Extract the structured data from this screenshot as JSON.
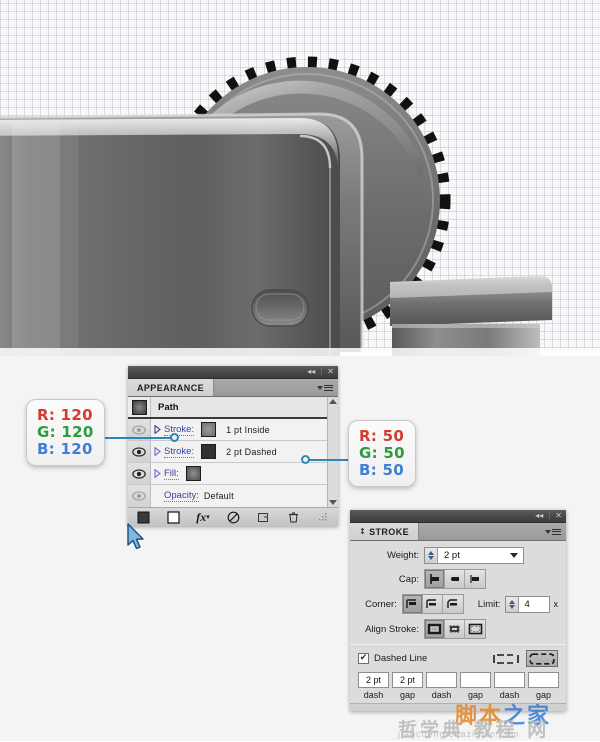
{
  "artboard": {
    "description": "Adobe Illustrator artboard showing a grayscale vector webcam / appliance illustration on a transparency grid"
  },
  "appearance_panel": {
    "window": {
      "collapse_label": "◂◂",
      "close_label": "✕",
      "separator": "|"
    },
    "tab_label": "APPEARANCE",
    "rows": [
      {
        "name": "path-row",
        "label": "Path",
        "value": "",
        "has_visibility": false,
        "has_disclosure": false,
        "has_thumbnail": true
      },
      {
        "name": "stroke-inside-row",
        "label": "Stroke:",
        "value": "1 pt  Inside",
        "swatch": "#808080",
        "has_visibility": true,
        "has_disclosure": true
      },
      {
        "name": "stroke-dashed-row",
        "label": "Stroke:",
        "value": "2 pt Dashed",
        "swatch": "#323232",
        "has_visibility": true,
        "has_disclosure": true
      },
      {
        "name": "fill-row",
        "label": "Fill:",
        "value": "",
        "swatch": "#6e6e6e",
        "has_visibility": true,
        "has_disclosure": true
      },
      {
        "name": "opacity-row",
        "label": "Opacity:",
        "value": "Default",
        "has_visibility": true,
        "has_disclosure": false
      }
    ],
    "footer_icons": [
      {
        "name": "add-new-stroke-icon",
        "glyph": "■"
      },
      {
        "name": "add-new-fill-icon",
        "glyph": "□"
      },
      {
        "name": "add-new-effect-icon",
        "glyph": "fx"
      },
      {
        "name": "clear-appearance-icon",
        "glyph": "⊘"
      },
      {
        "name": "duplicate-item-icon",
        "glyph": "⧉"
      },
      {
        "name": "delete-item-icon",
        "glyph": "🗑"
      }
    ]
  },
  "stroke_panel": {
    "window": {
      "collapse_label": "◂◂",
      "close_label": "✕",
      "separator": "|"
    },
    "tab_label": "STROKE",
    "weight": {
      "label": "Weight:",
      "value": "2 pt"
    },
    "cap": {
      "label": "Cap:",
      "options": [
        "butt-cap",
        "round-cap",
        "projecting-cap"
      ],
      "selected": 0
    },
    "corner": {
      "label": "Corner:",
      "options": [
        "miter-join",
        "round-join",
        "bevel-join"
      ],
      "selected": 0
    },
    "limit": {
      "label": "Limit:",
      "value": "4",
      "unit": "x"
    },
    "align_stroke": {
      "label": "Align Stroke:",
      "options": [
        "align-center",
        "align-inside",
        "align-outside"
      ],
      "selected": 0
    },
    "dashed_line": {
      "label": "Dashed Line",
      "checked": true,
      "check_glyph": "✔"
    },
    "dash_preview": [
      {
        "name": "preserve-exact-dash-button",
        "selected": false
      },
      {
        "name": "align-dashes-to-corners-button",
        "selected": true
      }
    ],
    "dash_fields": [
      {
        "caption": "dash",
        "value": "2 pt"
      },
      {
        "caption": "gap",
        "value": "2 pt"
      },
      {
        "caption": "dash",
        "value": ""
      },
      {
        "caption": "gap",
        "value": ""
      },
      {
        "caption": "dash",
        "value": ""
      },
      {
        "caption": "gap",
        "value": ""
      }
    ]
  },
  "callouts": [
    {
      "name": "rgb-callout-120",
      "r": "R: 120",
      "g": "G: 120",
      "b": "B: 120"
    },
    {
      "name": "rgb-callout-50",
      "r": "R: 50",
      "g": "G: 50",
      "b": "B: 50"
    }
  ],
  "colors": {
    "red": "#d43a2f",
    "green": "#2e9b3f",
    "blue": "#3d7fd6",
    "leader": "#2f86b5",
    "panel_bg": "#dcdcdc",
    "label_link": "#3b3f9c"
  },
  "watermark": {
    "top_a": "脚本",
    "top_b": "之家",
    "mid": "哲学典 教程 网",
    "sub": "jiaocheng.chazidian.com"
  }
}
